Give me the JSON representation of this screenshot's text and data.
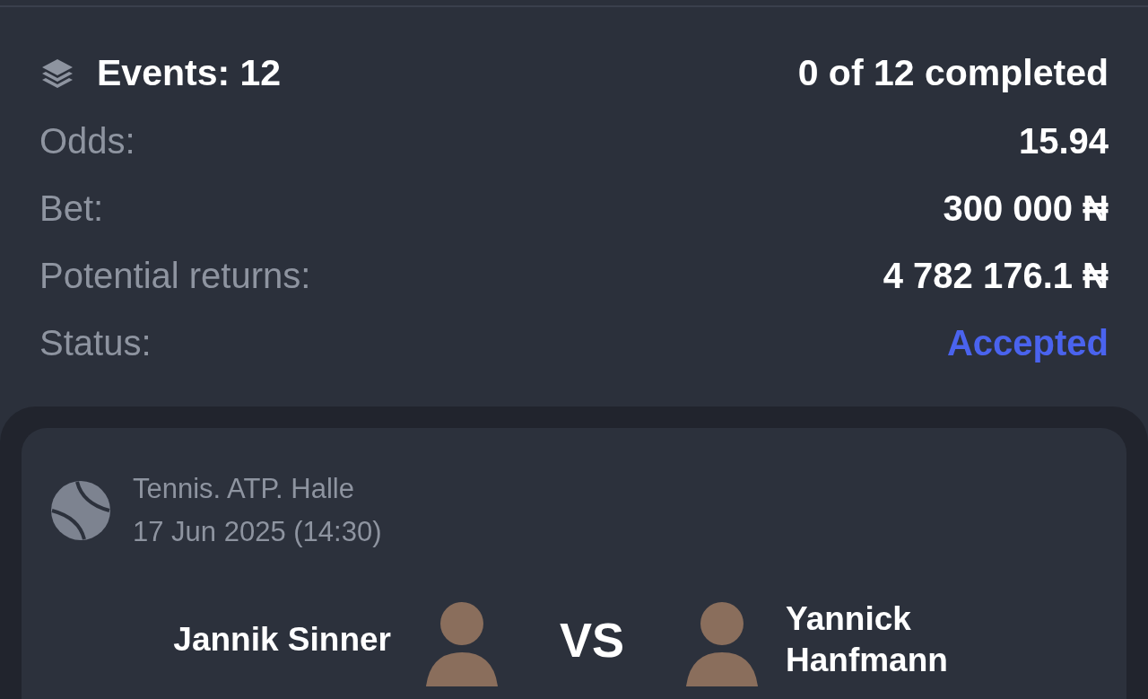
{
  "summary": {
    "events_label": "Events: 12",
    "completed": "0 of 12 completed",
    "rows": [
      {
        "label": "Odds:",
        "value": "15.94"
      },
      {
        "label": "Bet:",
        "value": "300 000 ₦"
      },
      {
        "label": "Potential returns:",
        "value": "4 782 176.1 ₦"
      },
      {
        "label": "Status:",
        "value": "Accepted",
        "kind": "status_accepted"
      }
    ]
  },
  "event": {
    "league": "Tennis. ATP. Halle",
    "datetime": "17 Jun 2025 (14:30)",
    "home": "Jannik Sinner",
    "vs": "VS",
    "away": "Yannick Hanfmann"
  }
}
